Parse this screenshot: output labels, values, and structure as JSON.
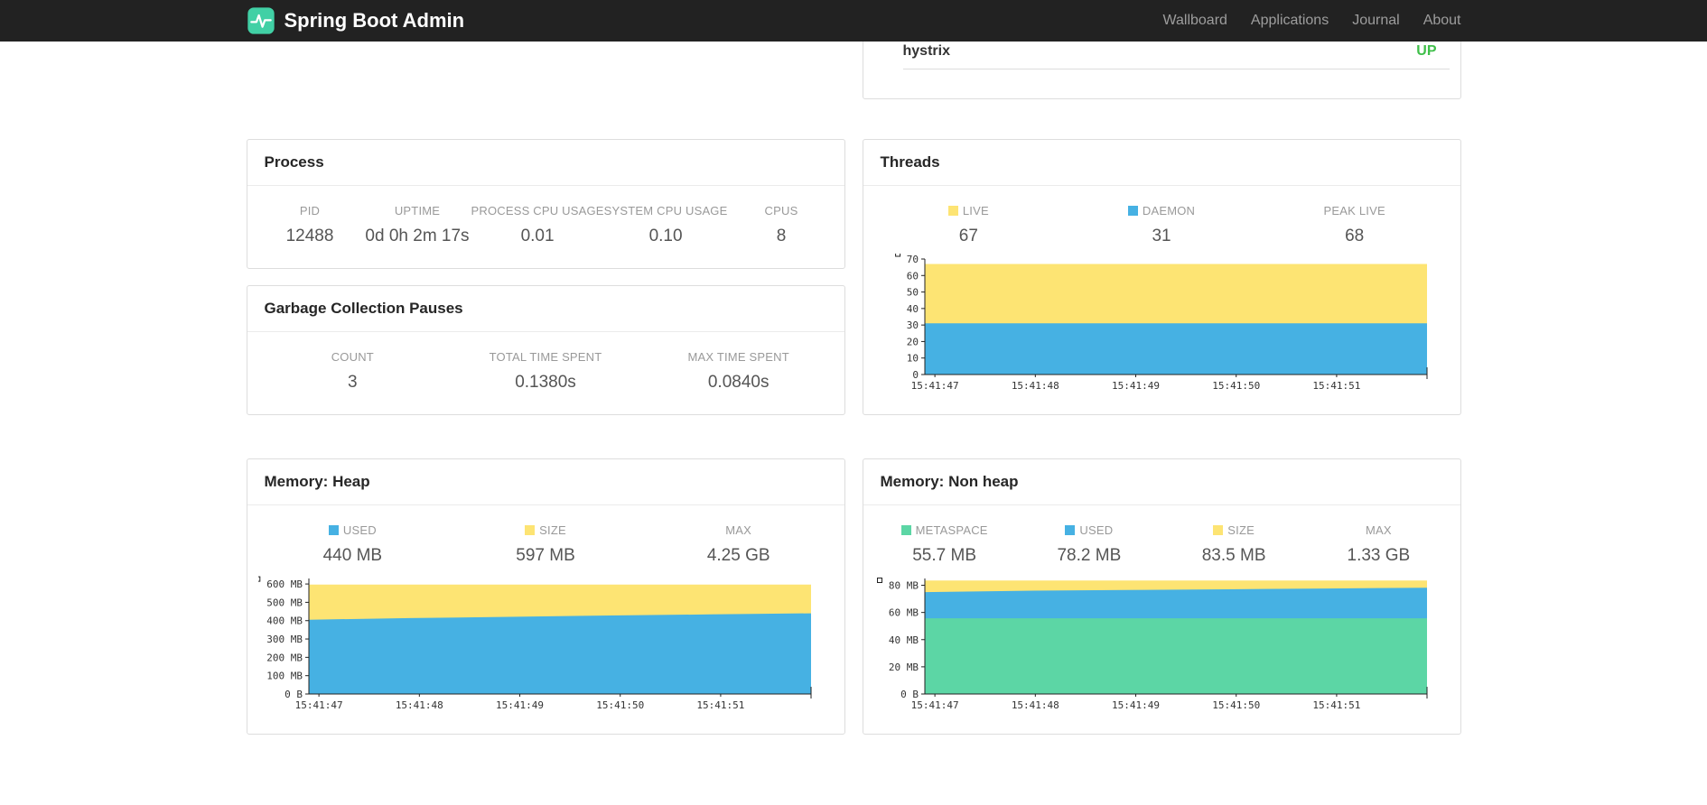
{
  "navbar": {
    "brand": "Spring Boot Admin",
    "items": [
      {
        "label": "Wallboard"
      },
      {
        "label": "Applications"
      },
      {
        "label": "Journal"
      },
      {
        "label": "About"
      }
    ]
  },
  "applications": {
    "rows": [
      {
        "name": "hystrix",
        "status": "UP",
        "status_color": "#3fbf4a"
      }
    ]
  },
  "cards": {
    "process": {
      "title": "Process",
      "stats": [
        {
          "label": "PID",
          "value": "12488"
        },
        {
          "label": "UPTIME",
          "value": "0d 0h 2m 17s"
        },
        {
          "label": "PROCESS CPU USAGE",
          "value": "0.01"
        },
        {
          "label": "SYSTEM CPU USAGE",
          "value": "0.10"
        },
        {
          "label": "CPUS",
          "value": "8"
        }
      ]
    },
    "gc": {
      "title": "Garbage Collection Pauses",
      "stats": [
        {
          "label": "COUNT",
          "value": "3"
        },
        {
          "label": "TOTAL TIME SPENT",
          "value": "0.1380s"
        },
        {
          "label": "MAX TIME SPENT",
          "value": "0.0840s"
        }
      ]
    },
    "threads": {
      "title": "Threads",
      "stats": [
        {
          "label": "LIVE",
          "value": "67",
          "swatch": "#fde473"
        },
        {
          "label": "DAEMON",
          "value": "31",
          "swatch": "#46b1e3"
        },
        {
          "label": "PEAK LIVE",
          "value": "68"
        }
      ]
    },
    "heap": {
      "title": "Memory: Heap",
      "stats": [
        {
          "label": "USED",
          "value": "440 MB",
          "swatch": "#46b1e3"
        },
        {
          "label": "SIZE",
          "value": "597 MB",
          "swatch": "#fde473"
        },
        {
          "label": "MAX",
          "value": "4.25 GB"
        }
      ]
    },
    "nonheap": {
      "title": "Memory: Non heap",
      "stats": [
        {
          "label": "METASPACE",
          "value": "55.7 MB",
          "swatch": "#5cd6a5"
        },
        {
          "label": "USED",
          "value": "78.2 MB",
          "swatch": "#46b1e3"
        },
        {
          "label": "SIZE",
          "value": "83.5 MB",
          "swatch": "#fde473"
        },
        {
          "label": "MAX",
          "value": "1.33 GB"
        }
      ]
    }
  },
  "chart_data": [
    {
      "id": "threads",
      "type": "area",
      "title": "Threads",
      "x_labels": [
        "15:41:47",
        "15:41:48",
        "15:41:49",
        "15:41:50",
        "15:41:51"
      ],
      "xtick_fracs": [
        0.02,
        0.22,
        0.42,
        0.62,
        0.82
      ],
      "series": [
        {
          "name": "LIVE",
          "color": "#fde473",
          "values": [
            67,
            67,
            67,
            67,
            67,
            67
          ]
        },
        {
          "name": "DAEMON",
          "color": "#46b1e3",
          "values": [
            31,
            31,
            31,
            31,
            31,
            31
          ]
        }
      ],
      "ylim": [
        0,
        70
      ],
      "yticks": [
        0,
        10,
        20,
        30,
        40,
        50,
        60,
        70
      ],
      "ytick_labels": [
        "0",
        "10",
        "20",
        "30",
        "40",
        "50",
        "60",
        "70"
      ],
      "grid": false,
      "legend_position": "top"
    },
    {
      "id": "heap",
      "type": "area",
      "title": "Memory: Heap",
      "x_labels": [
        "15:41:47",
        "15:41:48",
        "15:41:49",
        "15:41:50",
        "15:41:51"
      ],
      "xtick_fracs": [
        0.02,
        0.22,
        0.42,
        0.62,
        0.82
      ],
      "series": [
        {
          "name": "SIZE",
          "color": "#fde473",
          "values": [
            597,
            597,
            597,
            597,
            597,
            597
          ]
        },
        {
          "name": "USED",
          "color": "#46b1e3",
          "values": [
            405,
            414,
            421,
            428,
            434,
            440
          ]
        }
      ],
      "ylim": [
        0,
        630
      ],
      "yticks": [
        0,
        100,
        200,
        300,
        400,
        500,
        600
      ],
      "ytick_labels": [
        "0 B",
        "100 MB",
        "200 MB",
        "300 MB",
        "400 MB",
        "500 MB",
        "600 MB"
      ],
      "grid": false,
      "legend_position": "top"
    },
    {
      "id": "nonheap",
      "type": "area",
      "title": "Memory: Non heap",
      "x_labels": [
        "15:41:47",
        "15:41:48",
        "15:41:49",
        "15:41:50",
        "15:41:51"
      ],
      "xtick_fracs": [
        0.02,
        0.22,
        0.42,
        0.62,
        0.82
      ],
      "series": [
        {
          "name": "SIZE",
          "color": "#fde473",
          "values": [
            83.5,
            83.5,
            83.5,
            83.5,
            83.5,
            83.5
          ]
        },
        {
          "name": "USED",
          "color": "#46b1e3",
          "values": [
            75,
            76,
            76.5,
            77,
            77.6,
            78.2
          ]
        },
        {
          "name": "METASPACE",
          "color": "#5cd6a5",
          "values": [
            55.7,
            55.7,
            55.7,
            55.7,
            55.7,
            55.7
          ]
        }
      ],
      "ylim": [
        0,
        85
      ],
      "yticks": [
        0,
        20,
        40,
        60,
        80
      ],
      "ytick_labels": [
        "0 B",
        "20 MB",
        "40 MB",
        "60 MB",
        "80 MB"
      ],
      "grid": false,
      "legend_position": "top"
    }
  ]
}
